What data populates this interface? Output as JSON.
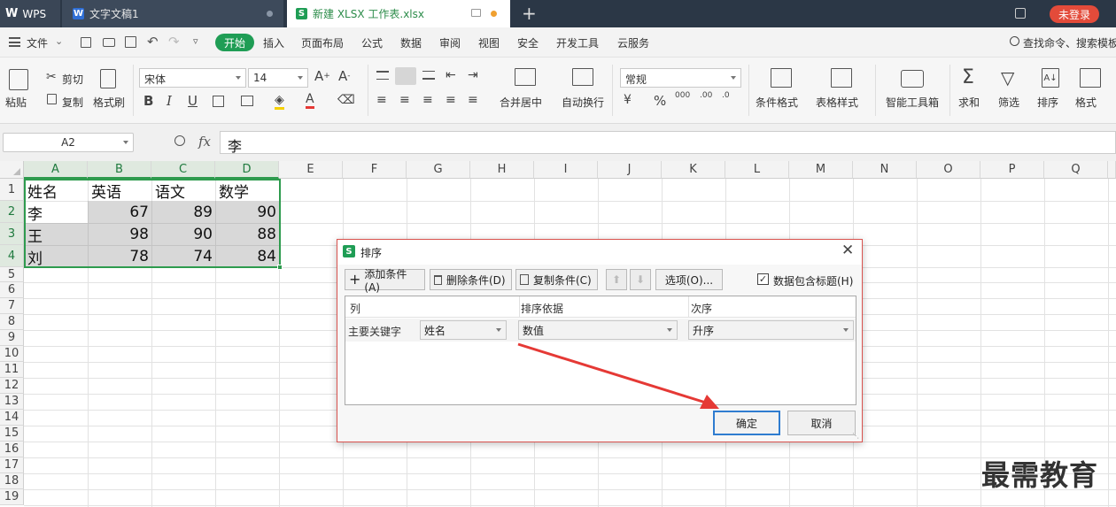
{
  "titlebar": {
    "tabs": [
      {
        "label": "WPS"
      },
      {
        "label": "文字文稿1"
      },
      {
        "label": "新建 XLSX 工作表.xlsx"
      }
    ],
    "login": "未登录"
  },
  "menubar": {
    "file": "文件",
    "items": [
      "开始",
      "插入",
      "页面布局",
      "公式",
      "数据",
      "审阅",
      "视图",
      "安全",
      "开发工具",
      "云服务"
    ],
    "search": "查找命令、搜索模板"
  },
  "ribbon": {
    "paste": "粘贴",
    "cut": "剪切",
    "copy": "复制",
    "format_painter": "格式刷",
    "font_name": "宋体",
    "font_size": "14",
    "merge_center": "合并居中",
    "wrap_text": "自动换行",
    "number_format": "常规",
    "conditional_format": "条件格式",
    "table_style": "表格样式",
    "smart_toolbox": "智能工具箱",
    "sum": "求和",
    "filter": "筛选",
    "sort": "排序",
    "format": "格式"
  },
  "formula_bar": {
    "name_box": "A2",
    "fx": "fx",
    "content": "李"
  },
  "grid": {
    "columns": [
      "A",
      "B",
      "C",
      "D",
      "E",
      "F",
      "G",
      "H",
      "I",
      "J",
      "K",
      "L",
      "M",
      "N",
      "O",
      "P",
      "Q"
    ],
    "rows": [
      "1",
      "2",
      "3",
      "4",
      "5",
      "6",
      "7",
      "8",
      "9",
      "10",
      "11",
      "12",
      "13",
      "14",
      "15",
      "16",
      "17",
      "18",
      "19"
    ],
    "header_row": [
      "姓名",
      "英语",
      "语文",
      "数学"
    ],
    "data_rows": [
      [
        "李",
        "67",
        "89",
        "90"
      ],
      [
        "王",
        "98",
        "90",
        "88"
      ],
      [
        "刘",
        "78",
        "74",
        "84"
      ]
    ]
  },
  "dialog": {
    "title": "排序",
    "add_condition": "添加条件(A)",
    "delete_condition": "删除条件(D)",
    "copy_condition": "复制条件(C)",
    "options": "选项(O)...",
    "has_header": "数据包含标题(H)",
    "has_header_checked": true,
    "col_header": "列",
    "sort_by_header": "排序依据",
    "order_header": "次序",
    "primary_key_label": "主要关键字",
    "primary_key": "姓名",
    "sort_on": "数值",
    "order": "升序",
    "ok": "确定",
    "cancel": "取消"
  },
  "watermark": "最需教育",
  "colors": {
    "accent_green": "#1f9d55",
    "title_bg": "#2b3746",
    "selection_green": "#2e9b4e",
    "arrow_red": "#e53935"
  }
}
